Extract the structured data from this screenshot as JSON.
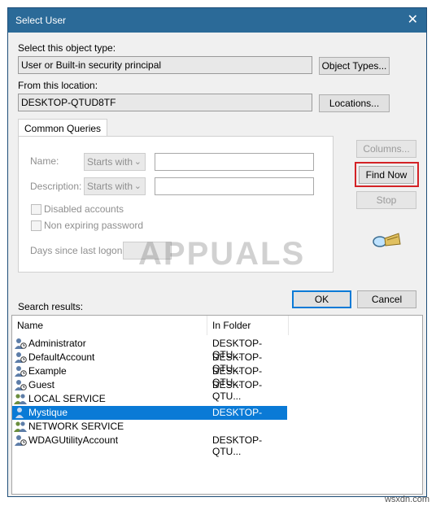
{
  "window": {
    "title": "Select User",
    "close_glyph": "✕"
  },
  "object_type": {
    "label": "Select this object type:",
    "value": "User or Built-in security principal",
    "button": "Object Types..."
  },
  "location": {
    "label": "From this location:",
    "value": "DESKTOP-QTUD8TF",
    "button": "Locations..."
  },
  "tab": "Common Queries",
  "queries": {
    "name_label": "Name:",
    "name_mode": "Starts with",
    "desc_label": "Description:",
    "desc_mode": "Starts with",
    "disabled_accounts": "Disabled accounts",
    "non_expiring": "Non expiring password",
    "days_label": "Days since last logon:"
  },
  "buttons": {
    "columns": "Columns...",
    "find_now": "Find Now",
    "stop": "Stop",
    "ok": "OK",
    "cancel": "Cancel"
  },
  "results": {
    "label": "Search results:",
    "columns": [
      "Name",
      "In Folder"
    ],
    "rows": [
      {
        "name": "Administrator",
        "folder": "DESKTOP-QTU..."
      },
      {
        "name": "DefaultAccount",
        "folder": "DESKTOP-QTU..."
      },
      {
        "name": "Example",
        "folder": "DESKTOP-QTU..."
      },
      {
        "name": "Guest",
        "folder": "DESKTOP-QTU..."
      },
      {
        "name": "LOCAL SERVICE",
        "folder": ""
      },
      {
        "name": "Mystique",
        "folder": "DESKTOP-QTU...",
        "selected": true
      },
      {
        "name": "NETWORK SERVICE",
        "folder": ""
      },
      {
        "name": "WDAGUtilityAccount",
        "folder": "DESKTOP-QTU..."
      }
    ]
  },
  "watermark": "APPUALS",
  "credit": "wsxdn.com",
  "colors": {
    "titlebar": "#2b6a98",
    "selection": "#0a7ad6",
    "highlight": "#d32226"
  }
}
